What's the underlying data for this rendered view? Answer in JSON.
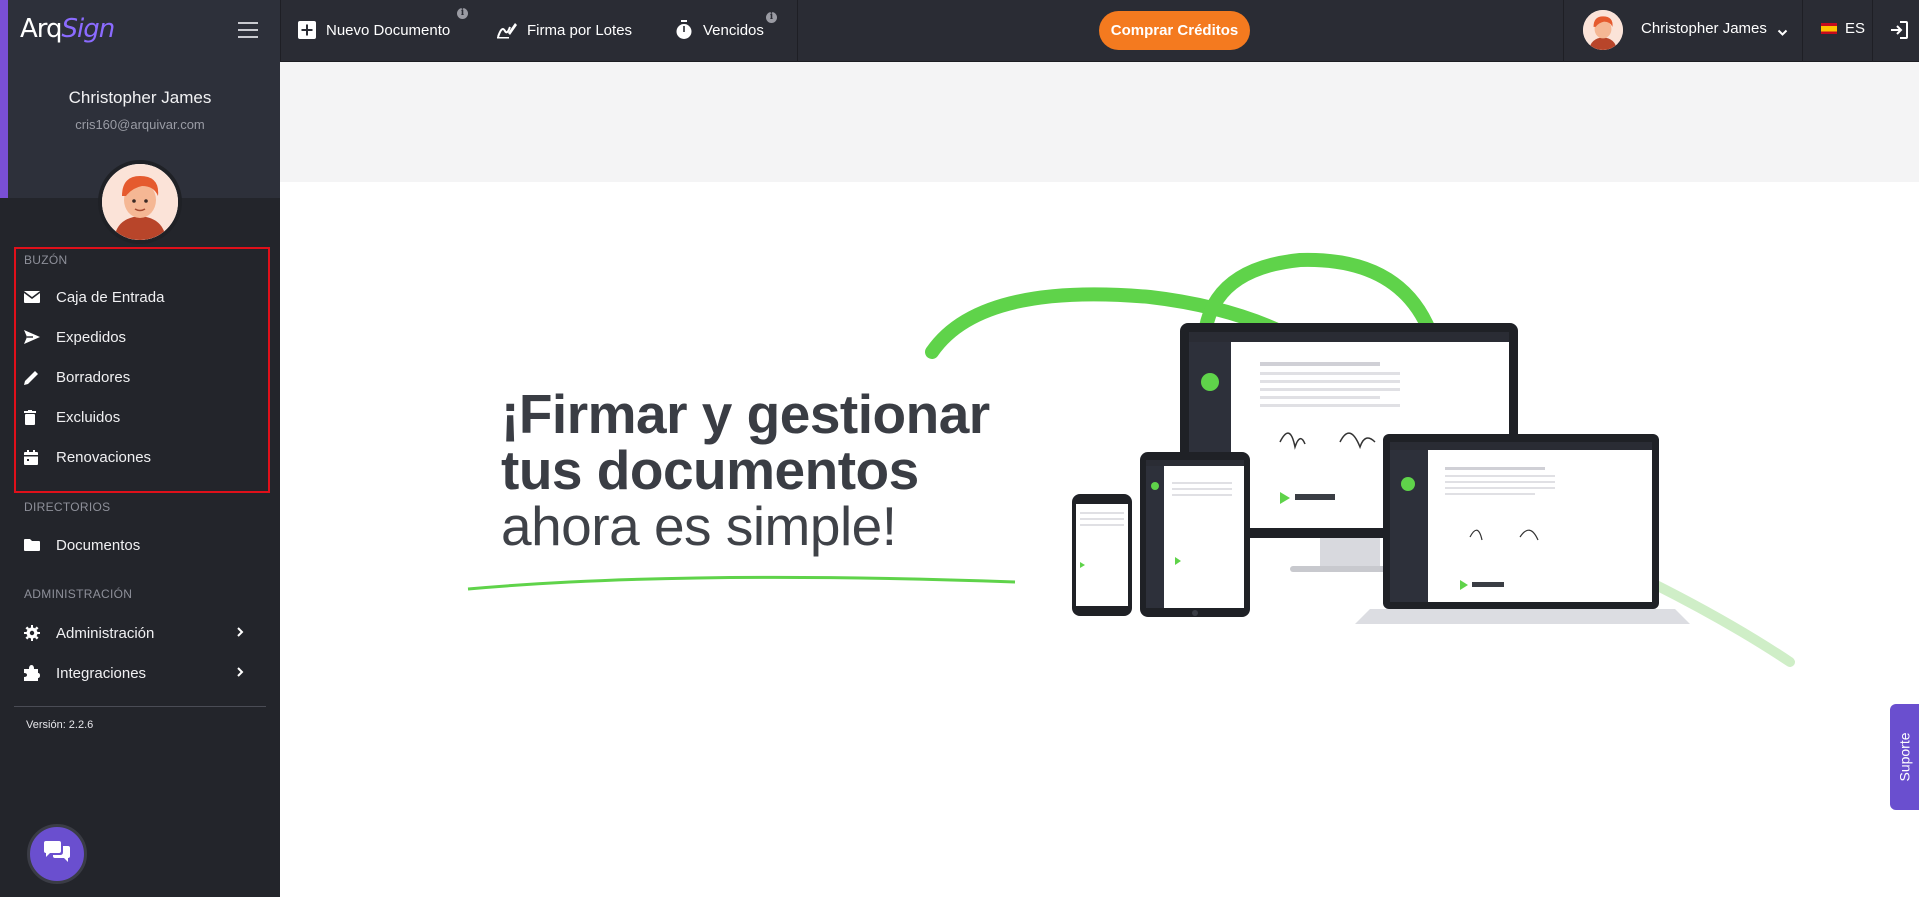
{
  "app": {
    "logo_prefix": "Arq",
    "logo_suffix": "Sign",
    "version": "Versión: 2.2.6"
  },
  "user": {
    "name": "Christopher James",
    "email": "cris160@arquivar.com"
  },
  "sidebar": {
    "sections": [
      {
        "label": "BUZÓN"
      },
      {
        "label": "DIRECTORIOS"
      },
      {
        "label": "ADMINISTRACIÓN"
      }
    ],
    "items": [
      {
        "label": "Caja de Entrada",
        "icon": "envelope-icon"
      },
      {
        "label": "Expedidos",
        "icon": "send-icon"
      },
      {
        "label": "Borradores",
        "icon": "pencil-icon"
      },
      {
        "label": "Excluidos",
        "icon": "trash-icon"
      },
      {
        "label": "Renovaciones",
        "icon": "calendar-icon"
      },
      {
        "label": "Documentos",
        "icon": "folder-icon"
      },
      {
        "label": "Administración",
        "icon": "gear-icon"
      },
      {
        "label": "Integraciones",
        "icon": "puzzle-icon"
      }
    ]
  },
  "topbar": {
    "new_document": "Nuevo Documento",
    "batch_sign": "Firma por Lotes",
    "expired": "Vencidos",
    "buy_credits": "Comprar Créditos",
    "user_name": "Christopher James",
    "language": "ES"
  },
  "hero": {
    "line1": "¡Firmar y gestionar",
    "line2": "tus documentos",
    "line3": "ahora es simple!"
  },
  "support": {
    "label": "Suporte"
  },
  "colors": {
    "accent": "#7a4fd6",
    "buy_button": "#f47a1f",
    "hero_green": "#5fd34a",
    "highlight": "#e0101a"
  }
}
